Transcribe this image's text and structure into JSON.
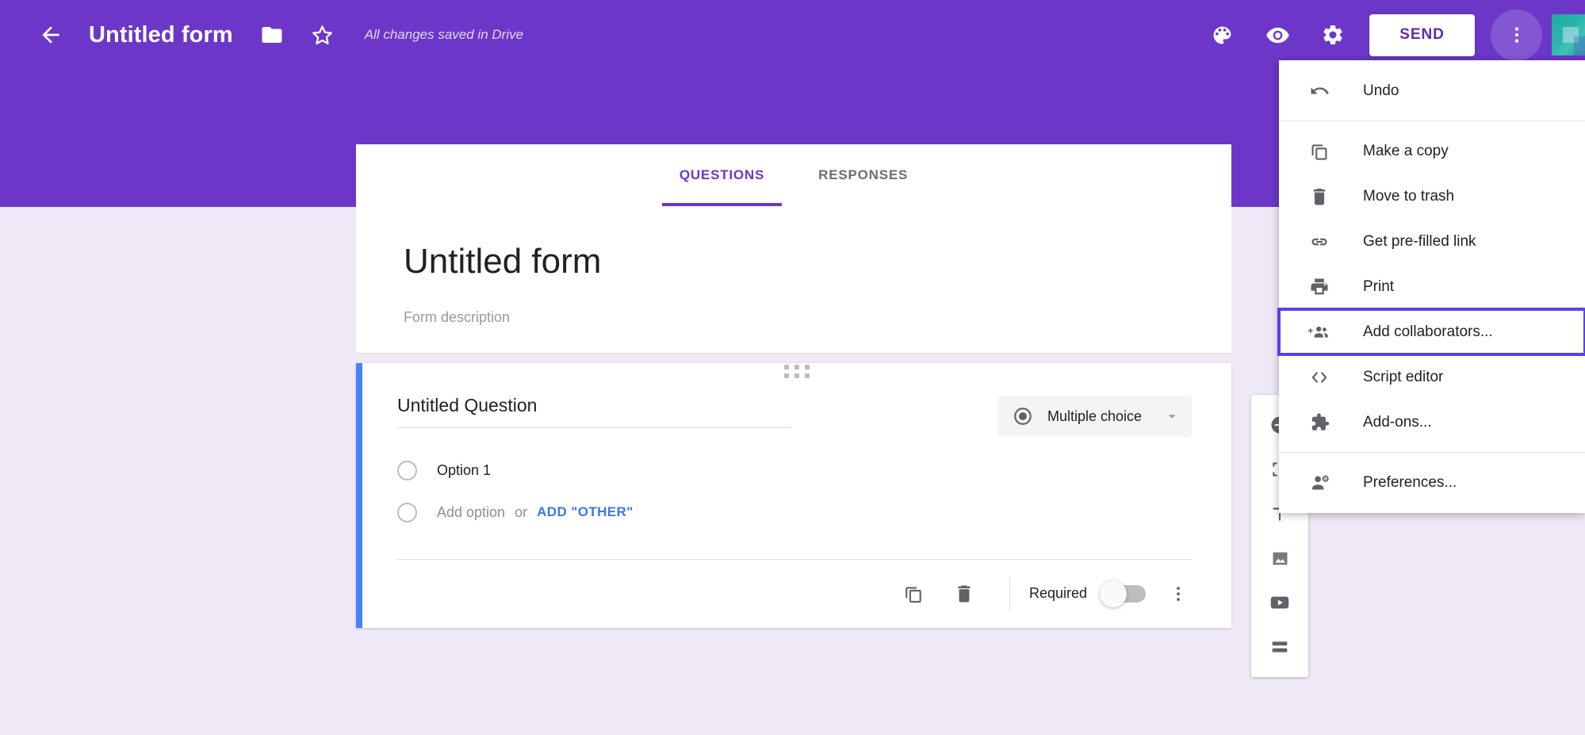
{
  "app": {
    "accent_purple": "#6C37C9",
    "page_background": "#EFE9F7",
    "card_accent_blue": "#4285F4",
    "highlight_border": "#5B3FF5"
  },
  "header": {
    "back_icon": "arrow-back-icon",
    "title": "Untitled form",
    "folder_icon": "folder-icon",
    "star_icon": "star-outline-icon",
    "save_status": "All changes saved in Drive",
    "theme_icon": "palette-icon",
    "preview_icon": "eye-preview-icon",
    "settings_icon": "gear-settings-icon",
    "send_label": "SEND",
    "more_icon": "kebab-more-icon",
    "avatar_name": "user-avatar"
  },
  "tabs": [
    {
      "label": "QUESTIONS",
      "active": true
    },
    {
      "label": "RESPONSES",
      "active": false
    }
  ],
  "form": {
    "title": "Untitled form",
    "description_placeholder": "Form description"
  },
  "question": {
    "drag_handle": "drag-handle-dots",
    "title": "Untitled Question",
    "type_icon": "radio-selected-icon",
    "type_label": "Multiple choice",
    "type_dropdown_icon": "chevron-down-icon",
    "options": [
      {
        "label": "Option 1",
        "placeholder": false
      }
    ],
    "add_option_label": "Add option",
    "or_label": "or",
    "add_other_label": "ADD \"OTHER\"",
    "actions": {
      "duplicate_icon": "duplicate-icon",
      "delete_icon": "trash-delete-icon",
      "required_label": "Required",
      "required_on": false,
      "more_icon": "kebab-more-icon"
    }
  },
  "float_toolbar": {
    "items": [
      {
        "name": "add-question-icon"
      },
      {
        "name": "import-questions-icon"
      },
      {
        "name": "add-title-description-icon"
      },
      {
        "name": "add-image-icon"
      },
      {
        "name": "add-video-icon"
      },
      {
        "name": "add-section-icon"
      }
    ]
  },
  "menu": {
    "items": [
      {
        "label": "Undo",
        "icon": "undo-icon",
        "highlighted": false,
        "separator_after": true
      },
      {
        "label": "Make a copy",
        "icon": "copy-icon",
        "highlighted": false,
        "separator_after": false
      },
      {
        "label": "Move to trash",
        "icon": "trash-icon",
        "highlighted": false,
        "separator_after": false
      },
      {
        "label": "Get pre-filled link",
        "icon": "link-icon",
        "highlighted": false,
        "separator_after": false
      },
      {
        "label": "Print",
        "icon": "print-icon",
        "highlighted": false,
        "separator_after": false
      },
      {
        "label": "Add collaborators...",
        "icon": "add-collaborators-icon",
        "highlighted": true,
        "separator_after": false
      },
      {
        "label": "Script editor",
        "icon": "code-brackets-icon",
        "highlighted": false,
        "separator_after": false
      },
      {
        "label": "Add-ons...",
        "icon": "puzzle-addons-icon",
        "highlighted": false,
        "separator_after": true
      },
      {
        "label": "Preferences...",
        "icon": "person-gear-preferences-icon",
        "highlighted": false,
        "separator_after": false
      }
    ]
  }
}
